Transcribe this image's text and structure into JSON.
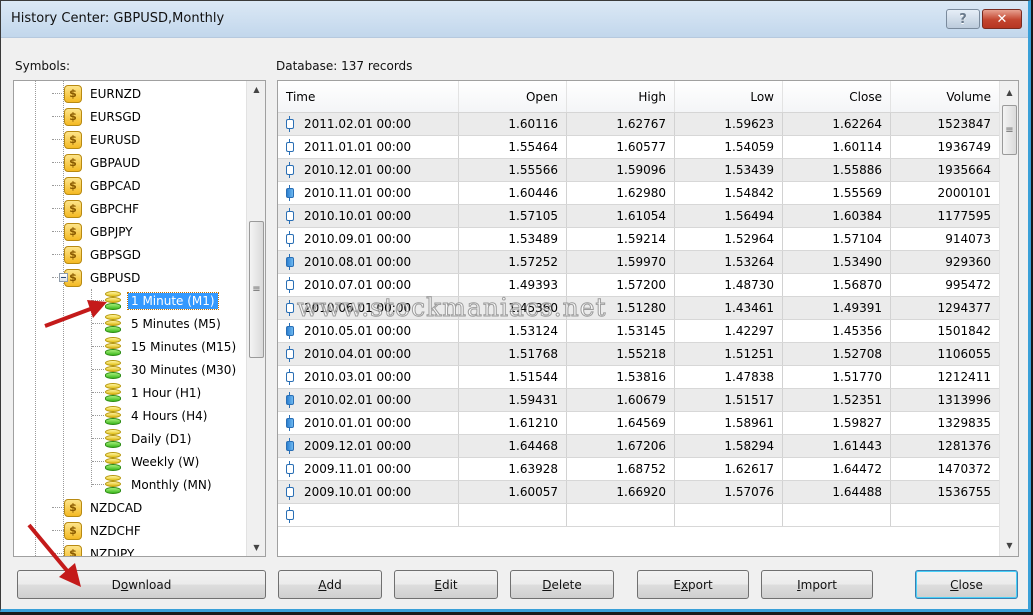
{
  "window": {
    "title": "History Center: GBPUSD,Monthly",
    "help_label": "?",
    "close_label": "✕"
  },
  "symbols_label": "Symbols:",
  "database_label": "Database: 137 records",
  "tree": {
    "symbols_before": [
      "EURNZD",
      "EURSGD",
      "EURUSD",
      "GBPAUD",
      "GBPCAD",
      "GBPCHF",
      "GBPJPY",
      "GBPSGD"
    ],
    "expanded_symbol": "GBPUSD",
    "timeframes": [
      {
        "label": "1 Minute (M1)",
        "selected": true
      },
      {
        "label": "5 Minutes (M5)",
        "selected": false
      },
      {
        "label": "15 Minutes (M15)",
        "selected": false
      },
      {
        "label": "30 Minutes (M30)",
        "selected": false
      },
      {
        "label": "1 Hour (H1)",
        "selected": false
      },
      {
        "label": "4 Hours (H4)",
        "selected": false
      },
      {
        "label": "Daily (D1)",
        "selected": false
      },
      {
        "label": "Weekly (W)",
        "selected": false
      },
      {
        "label": "Monthly (MN)",
        "selected": false
      }
    ],
    "symbols_after": [
      "NZDCAD",
      "NZDCHF",
      "NZDJPY"
    ],
    "symbol_icon": "dollar-icon",
    "timeframe_icon": "database-icon"
  },
  "table": {
    "columns": [
      "Time",
      "Open",
      "High",
      "Low",
      "Close",
      "Volume"
    ],
    "rows": [
      {
        "type": "bull",
        "time": "2011.02.01 00:00",
        "open": "1.60116",
        "high": "1.62767",
        "low": "1.59623",
        "close": "1.62264",
        "volume": "1523847"
      },
      {
        "type": "bull",
        "time": "2011.01.01 00:00",
        "open": "1.55464",
        "high": "1.60577",
        "low": "1.54059",
        "close": "1.60114",
        "volume": "1936749"
      },
      {
        "type": "bull",
        "time": "2010.12.01 00:00",
        "open": "1.55566",
        "high": "1.59096",
        "low": "1.53439",
        "close": "1.55886",
        "volume": "1935664"
      },
      {
        "type": "bear",
        "time": "2010.11.01 00:00",
        "open": "1.60446",
        "high": "1.62980",
        "low": "1.54842",
        "close": "1.55569",
        "volume": "2000101"
      },
      {
        "type": "bull",
        "time": "2010.10.01 00:00",
        "open": "1.57105",
        "high": "1.61054",
        "low": "1.56494",
        "close": "1.60384",
        "volume": "1177595"
      },
      {
        "type": "bull",
        "time": "2010.09.01 00:00",
        "open": "1.53489",
        "high": "1.59214",
        "low": "1.52964",
        "close": "1.57104",
        "volume": "914073"
      },
      {
        "type": "bear",
        "time": "2010.08.01 00:00",
        "open": "1.57252",
        "high": "1.59970",
        "low": "1.53264",
        "close": "1.53490",
        "volume": "929360"
      },
      {
        "type": "bull",
        "time": "2010.07.01 00:00",
        "open": "1.49393",
        "high": "1.57200",
        "low": "1.48730",
        "close": "1.56870",
        "volume": "995472"
      },
      {
        "type": "bull",
        "time": "2010.06.01 00:00",
        "open": "1.45360",
        "high": "1.51280",
        "low": "1.43461",
        "close": "1.49391",
        "volume": "1294377"
      },
      {
        "type": "bear",
        "time": "2010.05.01 00:00",
        "open": "1.53124",
        "high": "1.53145",
        "low": "1.42297",
        "close": "1.45356",
        "volume": "1501842"
      },
      {
        "type": "bull",
        "time": "2010.04.01 00:00",
        "open": "1.51768",
        "high": "1.55218",
        "low": "1.51251",
        "close": "1.52708",
        "volume": "1106055"
      },
      {
        "type": "bull",
        "time": "2010.03.01 00:00",
        "open": "1.51544",
        "high": "1.53816",
        "low": "1.47838",
        "close": "1.51770",
        "volume": "1212411"
      },
      {
        "type": "bear",
        "time": "2010.02.01 00:00",
        "open": "1.59431",
        "high": "1.60679",
        "low": "1.51517",
        "close": "1.52351",
        "volume": "1313996"
      },
      {
        "type": "bear",
        "time": "2010.01.01 00:00",
        "open": "1.61210",
        "high": "1.64569",
        "low": "1.58961",
        "close": "1.59827",
        "volume": "1329835"
      },
      {
        "type": "bear",
        "time": "2009.12.01 00:00",
        "open": "1.64468",
        "high": "1.67206",
        "low": "1.58294",
        "close": "1.61443",
        "volume": "1281376"
      },
      {
        "type": "bull",
        "time": "2009.11.01 00:00",
        "open": "1.63928",
        "high": "1.68752",
        "low": "1.62617",
        "close": "1.64472",
        "volume": "1470372"
      },
      {
        "type": "bull",
        "time": "2009.10.01 00:00",
        "open": "1.60057",
        "high": "1.66920",
        "low": "1.57076",
        "close": "1.64488",
        "volume": "1536755"
      }
    ]
  },
  "buttons": {
    "download": {
      "pre": "D",
      "ul": "o",
      "post": "wnload"
    },
    "add": {
      "pre": "",
      "ul": "A",
      "post": "dd"
    },
    "edit": {
      "pre": "",
      "ul": "E",
      "post": "dit"
    },
    "delete": {
      "pre": "",
      "ul": "D",
      "post": "elete"
    },
    "export": {
      "pre": "E",
      "ul": "x",
      "post": "port"
    },
    "import": {
      "pre": "",
      "ul": "I",
      "post": "mport"
    },
    "close": {
      "pre": "",
      "ul": "C",
      "post": "lose"
    }
  },
  "watermark": "www.stockmaniacs.net",
  "colors": {
    "selection": "#3399ff",
    "annotation_arrow": "#c41a1a",
    "window_accent": "#3aa0d8"
  }
}
